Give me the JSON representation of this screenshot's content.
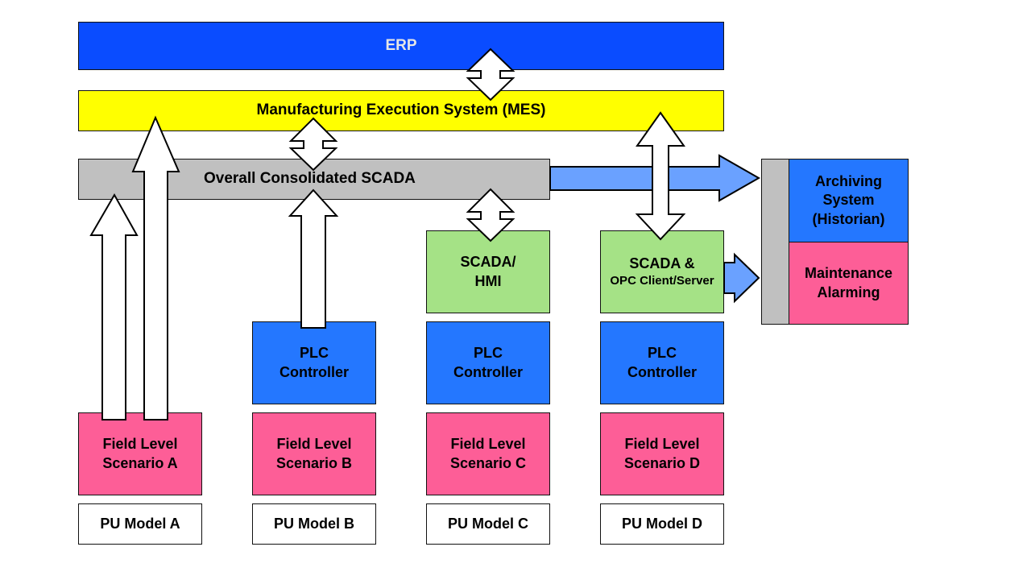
{
  "colors": {
    "erp": "#0a4cff",
    "mes": "#ffff00",
    "scada": "#c0c0c0",
    "hmi": "#a5e286",
    "plc": "#2477ff",
    "field": "#fd5e97",
    "pu": "#ffffff",
    "flow_arrow": "#6aa1ff",
    "erp_text": "#e6e6e6"
  },
  "layers": {
    "erp": "ERP",
    "mes": "Manufacturing Execution System (MES)",
    "scada": "Overall Consolidated SCADA"
  },
  "side_systems": {
    "archiving": [
      "Archiving",
      "System",
      "(Historian)"
    ],
    "maintenance": [
      "Maintenance",
      "Alarming"
    ]
  },
  "columns": [
    {
      "id": "a",
      "scada_hmi": null,
      "plc": null,
      "field": [
        "Field Level",
        "Scenario A"
      ],
      "pu": "PU Model A"
    },
    {
      "id": "b",
      "scada_hmi": null,
      "plc": [
        "PLC",
        "Controller"
      ],
      "field": [
        "Field Level",
        "Scenario B"
      ],
      "pu": "PU Model B"
    },
    {
      "id": "c",
      "scada_hmi": [
        "SCADA/",
        "HMI"
      ],
      "plc": [
        "PLC",
        "Controller"
      ],
      "field": [
        "Field Level",
        "Scenario C"
      ],
      "pu": "PU Model C"
    },
    {
      "id": "d",
      "scada_hmi": [
        "SCADA &",
        "OPC Client/Server"
      ],
      "plc": [
        "PLC",
        "Controller"
      ],
      "field": [
        "Field Level",
        "Scenario D"
      ],
      "pu": "PU Model D"
    }
  ],
  "connections": [
    {
      "from": "ERP",
      "to": "MES",
      "type": "bidirectional"
    },
    {
      "from": "MES",
      "to": "Overall Consolidated SCADA",
      "type": "bidirectional"
    },
    {
      "from": "Field Level Scenario A",
      "to": "Overall Consolidated SCADA",
      "type": "up"
    },
    {
      "from": "Field Level Scenario A",
      "to": "MES",
      "type": "up"
    },
    {
      "from": "PLC Controller B",
      "to": "Overall Consolidated SCADA",
      "type": "up"
    },
    {
      "from": "Overall Consolidated SCADA",
      "to": "SCADA/HMI",
      "type": "bidirectional"
    },
    {
      "from": "MES",
      "to": "SCADA & OPC Client/Server",
      "type": "bidirectional"
    },
    {
      "from": "Overall Consolidated SCADA",
      "to": "Archiving/Maintenance",
      "type": "flow"
    },
    {
      "from": "SCADA & OPC Client/Server",
      "to": "Archiving/Maintenance",
      "type": "flow"
    }
  ]
}
